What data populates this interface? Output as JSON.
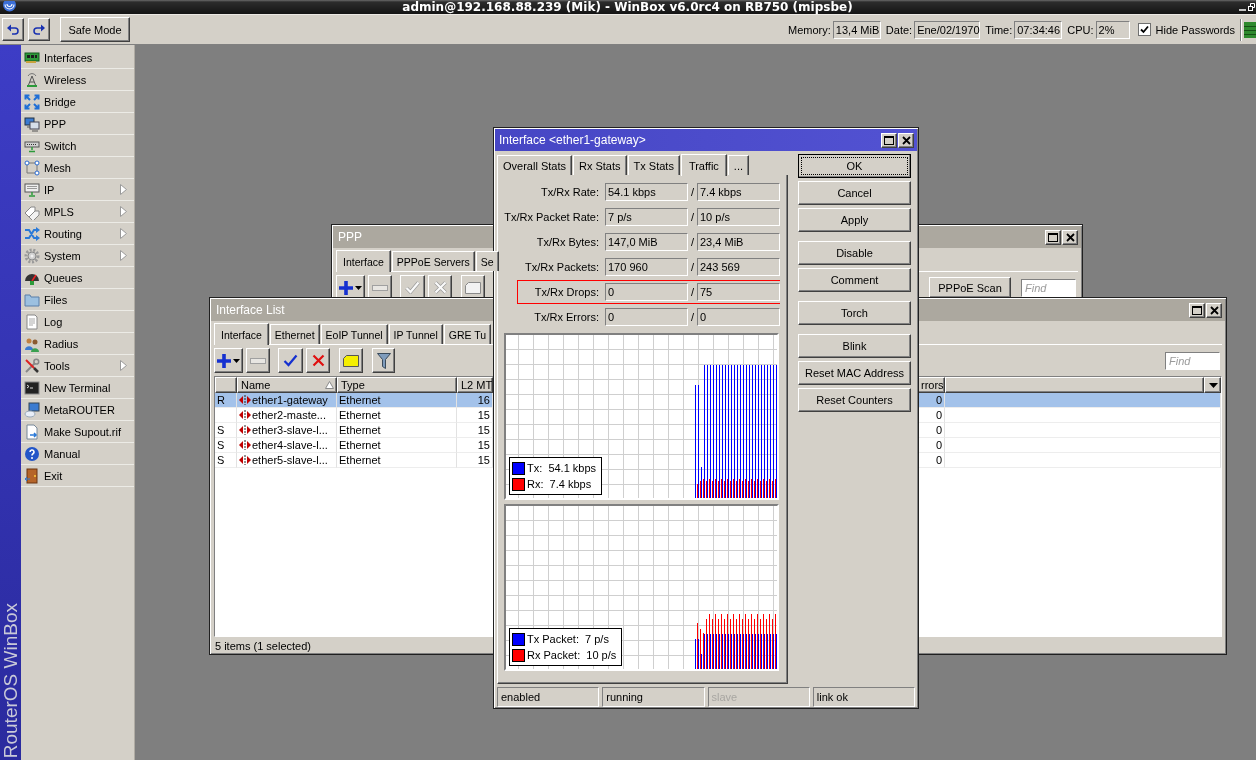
{
  "window": {
    "title": "admin@192.168.88.239 (Mik) - WinBox v6.0rc4 on RB750 (mipsbe)"
  },
  "toolbar": {
    "safe_mode": "Safe Mode",
    "stats": [
      {
        "label": "Memory:",
        "value": "13,4 MiB"
      },
      {
        "label": "Date:",
        "value": "Ene/02/1970"
      },
      {
        "label": "Time:",
        "value": "07:34:46"
      },
      {
        "label": "CPU:",
        "value": "2%"
      }
    ],
    "hide_passwords": {
      "label": "Hide Passwords",
      "checked": true
    }
  },
  "sidebar": {
    "brand": "RouterOS WinBox",
    "items": [
      {
        "label": "Interfaces",
        "submenu": false
      },
      {
        "label": "Wireless",
        "submenu": false
      },
      {
        "label": "Bridge",
        "submenu": false
      },
      {
        "label": "PPP",
        "submenu": false
      },
      {
        "label": "Switch",
        "submenu": false
      },
      {
        "label": "Mesh",
        "submenu": false
      },
      {
        "label": "IP",
        "submenu": true
      },
      {
        "label": "MPLS",
        "submenu": true
      },
      {
        "label": "Routing",
        "submenu": true
      },
      {
        "label": "System",
        "submenu": true
      },
      {
        "label": "Queues",
        "submenu": false
      },
      {
        "label": "Files",
        "submenu": false
      },
      {
        "label": "Log",
        "submenu": false
      },
      {
        "label": "Radius",
        "submenu": false
      },
      {
        "label": "Tools",
        "submenu": true
      },
      {
        "label": "New Terminal",
        "submenu": false
      },
      {
        "label": "MetaROUTER",
        "submenu": false
      },
      {
        "label": "Make Supout.rif",
        "submenu": false
      },
      {
        "label": "Manual",
        "submenu": false
      },
      {
        "label": "Exit",
        "submenu": false
      }
    ]
  },
  "ppp_window": {
    "title": "PPP",
    "active": false,
    "tabs": [
      {
        "label": "Interface",
        "selected": true
      },
      {
        "label": "PPPoE Servers",
        "selected": false
      },
      {
        "label": "Se",
        "selected": false
      }
    ],
    "tools": [
      {
        "kind": "add",
        "disabled": false
      },
      {
        "kind": "remove",
        "disabled": true
      },
      {
        "kind": "enable",
        "disabled": true
      },
      {
        "kind": "disable",
        "disabled": true
      },
      {
        "kind": "comment",
        "disabled": true
      }
    ],
    "scan_button": "PPPoE Scan",
    "find": {
      "placeholder": "Find"
    }
  },
  "interface_list": {
    "title": "Interface List",
    "active": false,
    "tabs": [
      {
        "label": "Interface",
        "selected": true
      },
      {
        "label": "Ethernet",
        "selected": false
      },
      {
        "label": "EoIP Tunnel",
        "selected": false
      },
      {
        "label": "IP Tunnel",
        "selected": false
      },
      {
        "label": "GRE Tu",
        "selected": false
      }
    ],
    "tools": [
      {
        "kind": "add",
        "disabled": false
      },
      {
        "kind": "remove",
        "disabled": true
      },
      {
        "kind": "enable",
        "disabled": false
      },
      {
        "kind": "disable",
        "disabled": false
      },
      {
        "kind": "comment",
        "disabled": false
      },
      {
        "kind": "filter",
        "disabled": false
      }
    ],
    "find": {
      "placeholder": "Find"
    },
    "table": {
      "columns": [
        {
          "label": "Name",
          "sorted": true
        },
        {
          "label": "Type",
          "sorted": false
        },
        {
          "label": "L2 MT",
          "sorted": false
        },
        {
          "label": "rrors",
          "sorted": false
        }
      ],
      "rows": [
        {
          "flag": "R",
          "name": "ether1-gateway",
          "type": "Ethernet",
          "l2_mtu": "16",
          "column_5": "0",
          "selected": true
        },
        {
          "name": "ether2-maste...",
          "type": "Ethernet",
          "l2_mtu": "15",
          "column_5": "0",
          "selected": false
        },
        {
          "flag": "S",
          "name": "ether3-slave-l...",
          "type": "Ethernet",
          "l2_mtu": "15",
          "column_5": "0",
          "selected": false
        },
        {
          "flag": "S",
          "name": "ether4-slave-l...",
          "type": "Ethernet",
          "l2_mtu": "15",
          "column_5": "0",
          "selected": false
        },
        {
          "flag": "S",
          "name": "ether5-slave-l...",
          "type": "Ethernet",
          "l2_mtu": "15",
          "column_5": "0",
          "selected": false
        }
      ]
    },
    "status": "5 items (1 selected)"
  },
  "interface_dialog": {
    "title": "Interface <ether1-gateway>",
    "active": true,
    "tabs": [
      {
        "label": "Overall Stats",
        "selected": false
      },
      {
        "label": "Rx Stats",
        "selected": false
      },
      {
        "label": "Tx Stats",
        "selected": false
      },
      {
        "label": "Traffic",
        "selected": true
      },
      {
        "label": "...",
        "selected": false
      }
    ],
    "stats": [
      {
        "label": "Tx/Rx Rate:",
        "tx": "54.1 kbps",
        "separator": "/",
        "rx": "7.4 kbps",
        "highlighted": false
      },
      {
        "label": "Tx/Rx Packet Rate:",
        "tx": "7 p/s",
        "separator": "/",
        "rx": "10 p/s",
        "highlighted": false
      },
      {
        "label": "Tx/Rx Bytes:",
        "tx": "147,0 MiB",
        "separator": "/",
        "rx": "23,4 MiB",
        "highlighted": false
      },
      {
        "label": "Tx/Rx Packets:",
        "tx": "170 960",
        "separator": "/",
        "rx": "243 569",
        "highlighted": false
      },
      {
        "label": "Tx/Rx Drops:",
        "tx": "0",
        "separator": "/",
        "rx": "75",
        "highlighted": true
      },
      {
        "label": "Tx/Rx Errors:",
        "tx": "0",
        "separator": "/",
        "rx": "0",
        "highlighted": false
      }
    ],
    "graphs": [
      {
        "legend": [
          {
            "text": "Tx:  54.1 kbps",
            "color": "#0000ff"
          },
          {
            "text": "Rx:  7.4 kbps",
            "color": "#ff0000"
          }
        ]
      },
      {
        "legend": [
          {
            "text": "Tx Packet:  7 p/s",
            "color": "#0000ff"
          },
          {
            "text": "Rx Packet:  10 p/s",
            "color": "#ff0000"
          }
        ]
      }
    ],
    "button_groups": [
      {
        "buttons": [
          {
            "label": "OK",
            "focused": true
          },
          {
            "label": "Cancel",
            "focused": false
          },
          {
            "label": "Apply",
            "focused": false
          }
        ]
      },
      {
        "buttons": [
          {
            "label": "Disable",
            "focused": false
          },
          {
            "label": "Comment",
            "focused": false
          }
        ]
      },
      {
        "buttons": [
          {
            "label": "Torch",
            "focused": false
          }
        ]
      },
      {
        "buttons": [
          {
            "label": "Blink",
            "focused": false
          },
          {
            "label": "Reset MAC Address",
            "focused": false
          },
          {
            "label": "Reset Counters",
            "focused": false
          }
        ]
      }
    ],
    "status": [
      {
        "text": "enabled",
        "disabled": false
      },
      {
        "text": "running",
        "disabled": false
      },
      {
        "text": "slave",
        "disabled": true
      },
      {
        "text": "link ok",
        "disabled": false
      }
    ]
  }
}
